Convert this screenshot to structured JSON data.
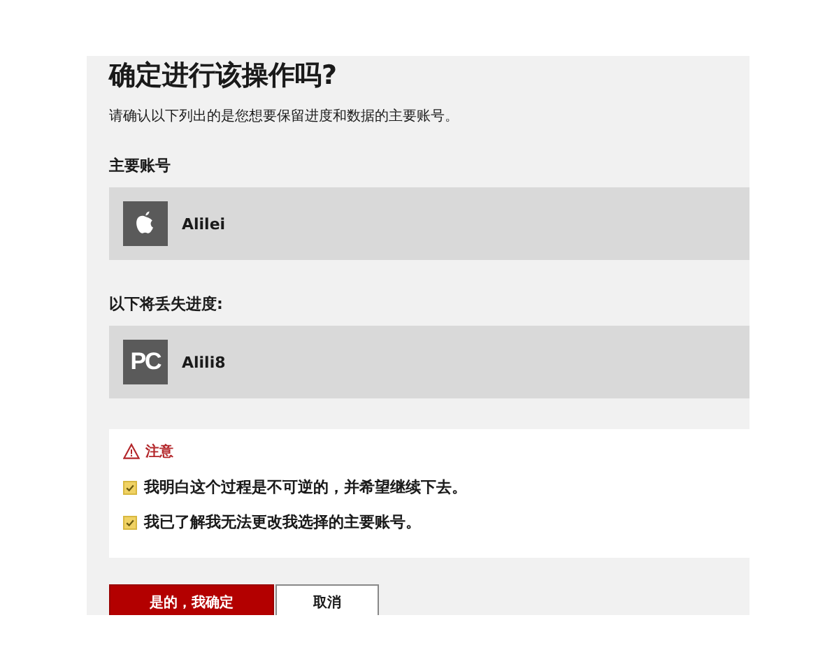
{
  "title": "确定进行该操作吗?",
  "subtitle": "请确认以下列出的是您想要保留进度和数据的主要账号。",
  "primary": {
    "label": "主要账号",
    "account": {
      "kind": "apple",
      "name": "Alilei"
    }
  },
  "lost": {
    "label": "以下将丢失进度:",
    "account": {
      "kind": "pc",
      "badge": "PC",
      "name": "Alili8"
    }
  },
  "notice": {
    "title": "注意",
    "items": [
      {
        "text": "我明白这个过程是不可逆的，并希望继续下去。",
        "checked": true
      },
      {
        "text": "我已了解我无法更改我选择的主要账号。",
        "checked": true
      }
    ]
  },
  "buttons": {
    "confirm": "是的，我确定",
    "cancel": "取消"
  }
}
